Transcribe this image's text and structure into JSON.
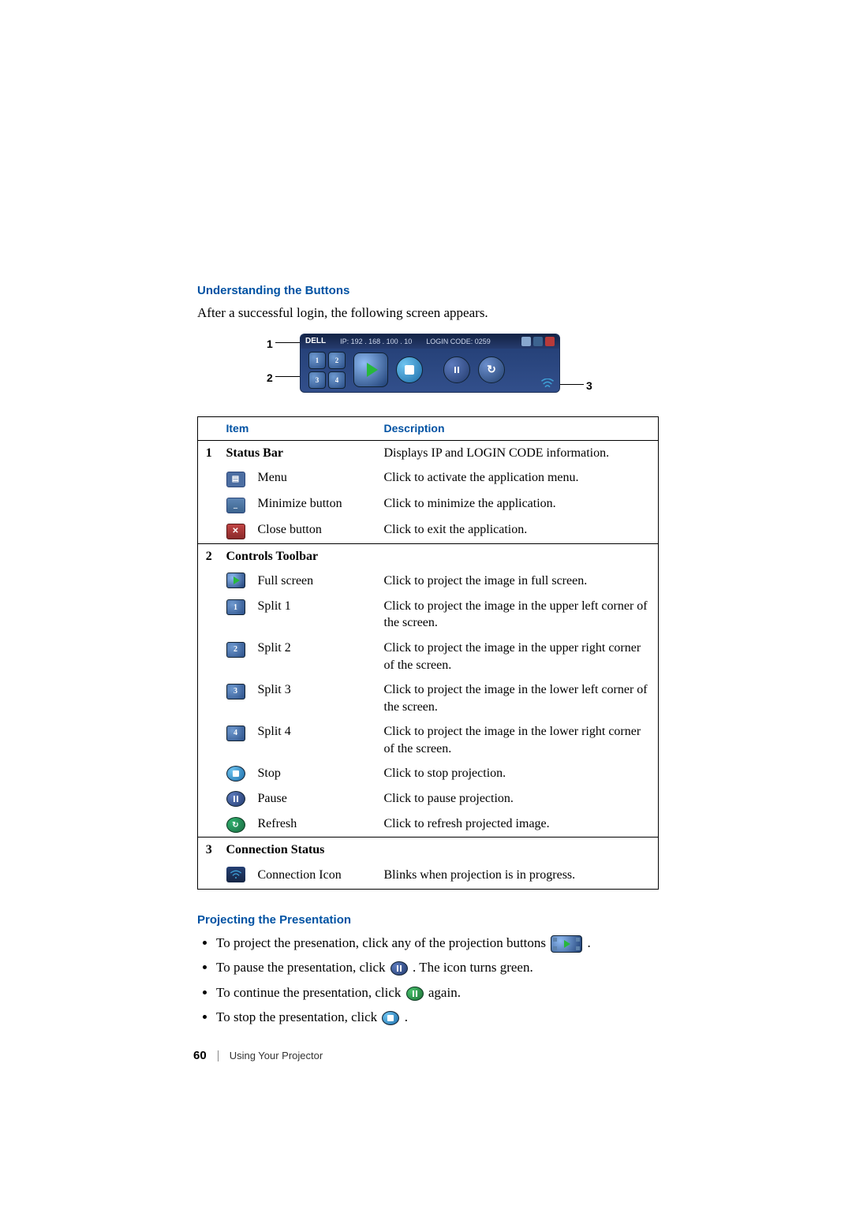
{
  "page": {
    "number": "60",
    "chapter": "Using Your Projector"
  },
  "section1": {
    "heading": "Understanding the Buttons",
    "intro": "After a successful login, the following screen appears."
  },
  "figure": {
    "callouts": {
      "c1": "1",
      "c2": "2",
      "c3": "3"
    },
    "statusbar": {
      "brand": "DELL",
      "ip_label": "IP:",
      "ip_value": "192 . 168 . 100 . 10",
      "login_label": "LOGIN CODE:",
      "login_value": "0259"
    }
  },
  "table": {
    "head_item": "Item",
    "head_desc": "Description",
    "rows": [
      {
        "num": "1",
        "group": "Status Bar",
        "desc": "Displays IP and LOGIN CODE information."
      },
      {
        "icon": "menu",
        "name": "Menu",
        "desc": "Click to activate the application menu."
      },
      {
        "icon": "minimize",
        "name": "Minimize button",
        "desc": "Click to minimize the application."
      },
      {
        "icon": "close",
        "name": "Close button",
        "desc": "Click to exit the application."
      },
      {
        "num": "2",
        "group": "Controls Toolbar"
      },
      {
        "icon": "play",
        "name": "Full screen",
        "desc": "Click to project the image in full screen."
      },
      {
        "icon": "split1",
        "name": "Split 1",
        "desc": "Click to project the image in the upper left corner of the screen."
      },
      {
        "icon": "split2",
        "name": "Split 2",
        "desc": "Click to project the image in the upper right corner of the screen."
      },
      {
        "icon": "split3",
        "name": "Split 3",
        "desc": "Click to project the image in the lower left corner of the screen."
      },
      {
        "icon": "split4",
        "name": "Split 4",
        "desc": "Click to project the image in the lower right corner of the screen."
      },
      {
        "icon": "stop",
        "name": "Stop",
        "desc": "Click to stop projection."
      },
      {
        "icon": "pause",
        "name": "Pause",
        "desc": "Click to pause projection."
      },
      {
        "icon": "refresh",
        "name": "Refresh",
        "desc": "Click to refresh projected image."
      },
      {
        "num": "3",
        "group": "Connection Status"
      },
      {
        "icon": "conn",
        "name": "Connection Icon",
        "desc": "Blinks when projection is in progress."
      }
    ]
  },
  "section2": {
    "heading": "Projecting the Presentation",
    "bullets": {
      "b1_a": "To project the presenation, click any of the projection buttons ",
      "b1_b": ".",
      "b2_a": "To pause the presentation, click ",
      "b2_b": ". The icon turns green.",
      "b3_a": "To continue the presentation, click ",
      "b3_b": " again.",
      "b4_a": "To stop the presentation, click ",
      "b4_b": "."
    }
  }
}
